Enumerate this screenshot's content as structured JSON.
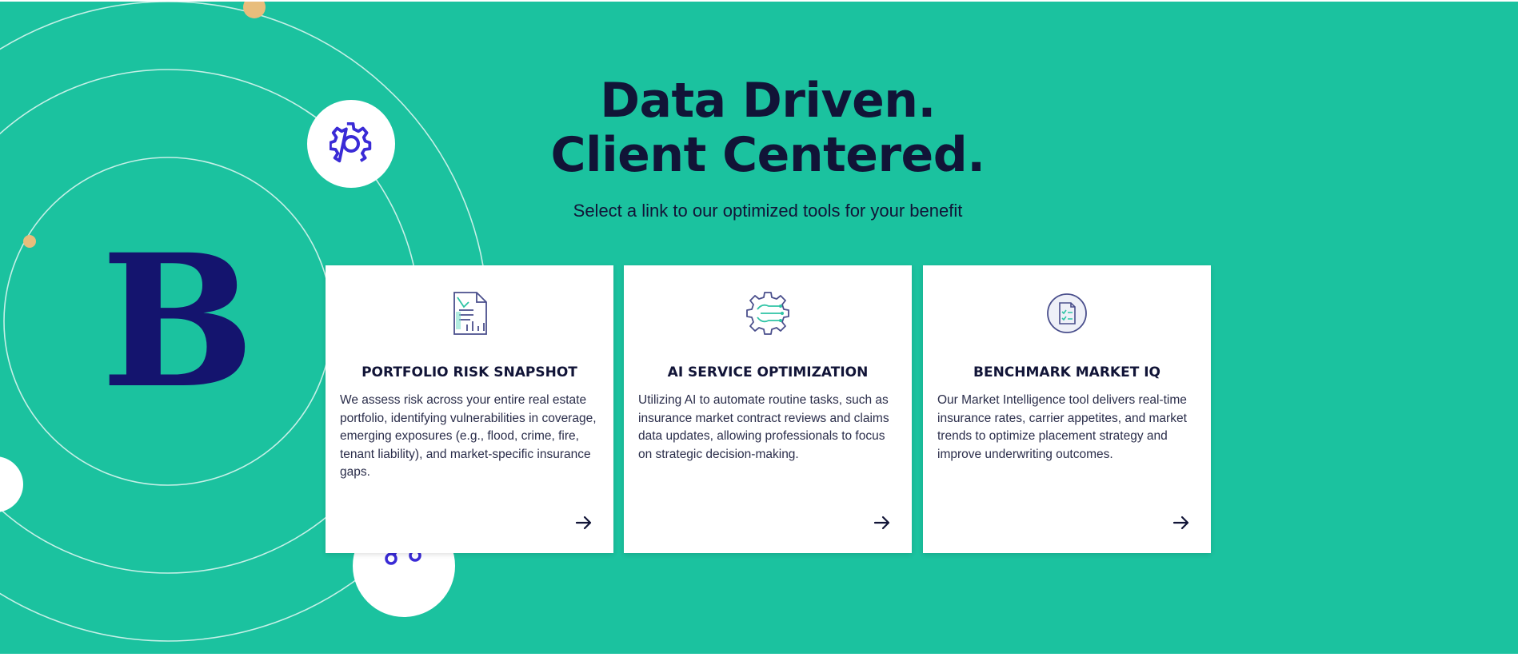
{
  "hero": {
    "heading_line1": "Data Driven.",
    "heading_line2": "Client Centered.",
    "subtitle": "Select a link to our optimized tools for your benefit",
    "logo_letter": "B"
  },
  "decor_icons": [
    "gear-icon",
    "network-icon"
  ],
  "cards": [
    {
      "title": "PORTFOLIO RISK SNAPSHOT",
      "description": "We assess risk across your entire real estate portfolio, identifying vulnerabilities in coverage, emerging exposures (e.g., flood, crime, fire, tenant liability), and market-specific insurance gaps.",
      "icon": "document-chart-icon"
    },
    {
      "title": "AI SERVICE OPTIMIZATION",
      "description": "Utilizing AI to automate routine tasks, such as insurance market contract reviews and claims data updates, allowing professionals to focus on strategic decision-making.",
      "icon": "ai-gear-icon"
    },
    {
      "title": "BENCHMARK MARKET IQ",
      "description": "Our Market Intelligence tool delivers real-time insurance rates, carrier appetites, and market trends to optimize placement strategy and improve underwriting outcomes.",
      "icon": "checklist-icon"
    }
  ],
  "colors": {
    "background": "#1bc29f",
    "navy": "#14146e",
    "heading": "#111437",
    "accent_indigo": "#3a2bd6",
    "orbit_dot": "#e8bd7c",
    "card": "#ffffff"
  }
}
